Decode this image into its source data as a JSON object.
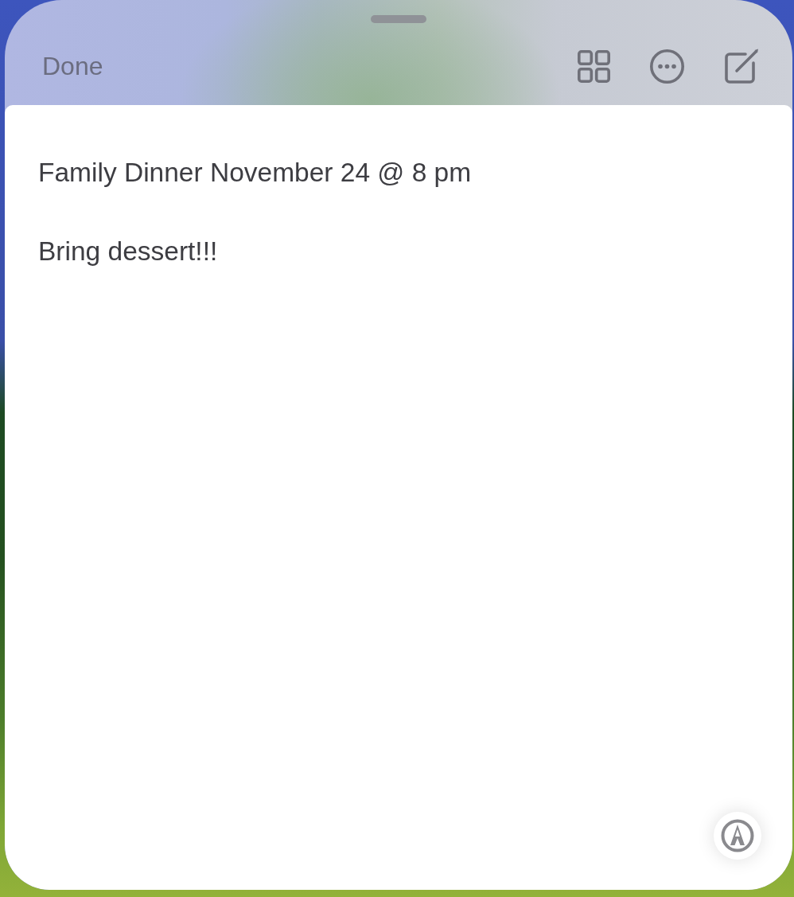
{
  "toolbar": {
    "done_button": "Done"
  },
  "note": {
    "paragraphs": [
      "Family Dinner November 24 @ 8 pm",
      "Bring dessert!!!"
    ]
  }
}
